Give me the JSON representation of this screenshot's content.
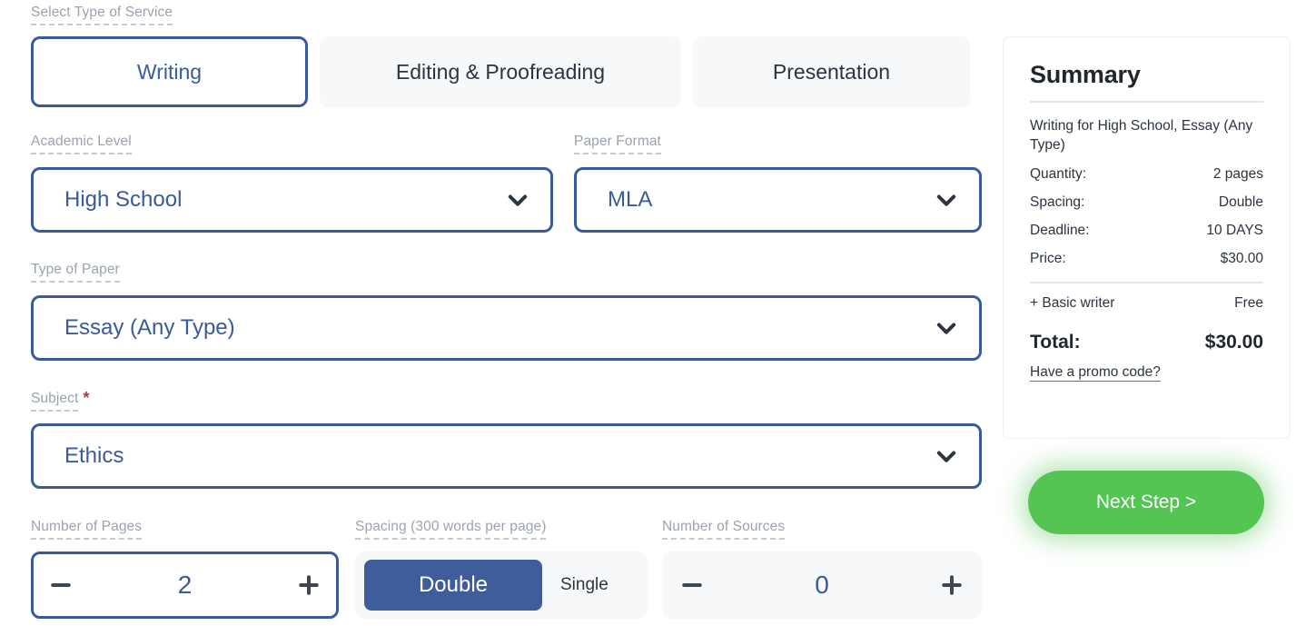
{
  "service": {
    "label": "Select Type of Service",
    "tabs": [
      {
        "label": "Writing",
        "active": true
      },
      {
        "label": "Editing & Proofreading",
        "active": false
      },
      {
        "label": "Presentation",
        "active": false
      }
    ]
  },
  "fields": {
    "academic_level": {
      "label": "Academic Level",
      "value": "High School",
      "icon": "chevron-down-icon"
    },
    "paper_format": {
      "label": "Paper Format",
      "value": "MLA",
      "icon": "chevron-down-icon"
    },
    "type_of_paper": {
      "label": "Type of Paper",
      "value": "Essay (Any Type)",
      "icon": "chevron-down-icon"
    },
    "subject": {
      "label": "Subject",
      "required_marker": "*",
      "value": "Ethics",
      "icon": "chevron-down-icon"
    }
  },
  "pages": {
    "label": "Number of Pages",
    "value": "2",
    "decrement_icon": "minus-icon",
    "increment_icon": "plus-icon"
  },
  "spacing": {
    "label": "Spacing (300 words per page)",
    "options": [
      "Double",
      "Single"
    ],
    "selected": "Double"
  },
  "sources": {
    "label": "Number of Sources",
    "value": "0",
    "decrement_icon": "minus-icon",
    "increment_icon": "plus-icon"
  },
  "summary": {
    "title": "Summary",
    "description": "Writing for High School, Essay (Any Type)",
    "rows": [
      {
        "label": "Quantity:",
        "value": "2 pages"
      },
      {
        "label": "Spacing:",
        "value": "Double"
      },
      {
        "label": "Deadline:",
        "value": "10 DAYS"
      },
      {
        "label": "Price:",
        "value": "$30.00"
      }
    ],
    "addon": {
      "label": "+ Basic writer",
      "value": "Free"
    },
    "total": {
      "label": "Total:",
      "value": "$30.00"
    },
    "promo_link": "Have a promo code?"
  },
  "cta": {
    "label": "Next Step >",
    "color": "#54c453"
  },
  "colors": {
    "accent_blue": "#3a5a9a",
    "label_grey": "#9aa3b0",
    "required_red": "#b3383f",
    "cta_green": "#54c453",
    "panel_grey": "#f7f8fa"
  }
}
